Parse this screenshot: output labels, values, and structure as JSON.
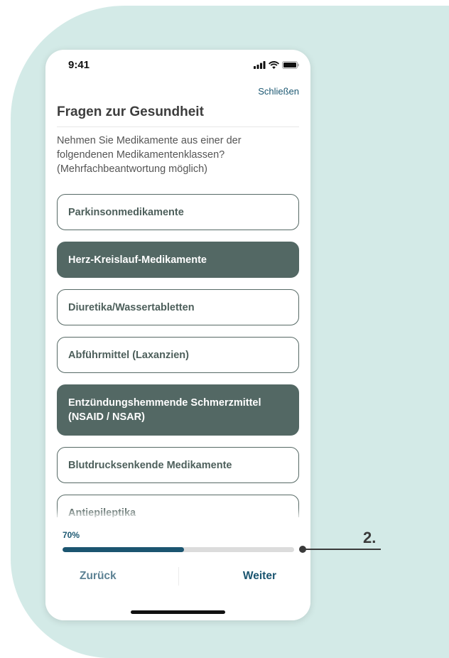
{
  "status_bar": {
    "time": "9:41",
    "icons": [
      "signal-icon",
      "wifi-icon",
      "battery-icon"
    ]
  },
  "header": {
    "close_label": "Schließen",
    "title": "Fragen zur Gesundheit"
  },
  "question": "Nehmen Sie Medikamente aus einer der folgendenen Medikamentenklassen? (Mehrfachbeantwortung möglich)",
  "options": [
    {
      "label": "Parkinsonmedikamente",
      "selected": false
    },
    {
      "label": "Herz-Kreislauf-Medikamente",
      "selected": true
    },
    {
      "label": "Diuretika/Wassertabletten",
      "selected": false
    },
    {
      "label": "Abführmittel (Laxanzien)",
      "selected": false
    },
    {
      "label": "Entzündungshemmende Schmerzmittel (NSAID / NSAR)",
      "selected": true
    },
    {
      "label": "Blutdrucksenkende Medikamente",
      "selected": false
    },
    {
      "label": "Antiepileptika",
      "selected": false
    }
  ],
  "progress": {
    "label": "70%",
    "fraction": 0.525
  },
  "navigation": {
    "back_label": "Zurück",
    "next_label": "Weiter"
  },
  "annotation": {
    "label": "2."
  },
  "colors": {
    "background": "#d3eae7",
    "accent": "#1b5570",
    "selected_option": "#536864",
    "option_border": "#566965",
    "annotation": "#3a3a3a"
  }
}
